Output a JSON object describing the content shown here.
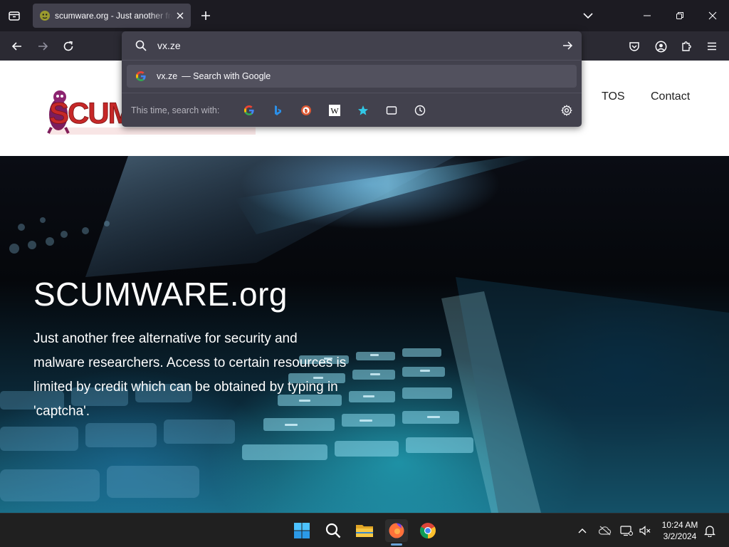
{
  "browser": {
    "tab": {
      "title": "scumware.org - Just another free alternative for security and malware researchers",
      "favicon": "scumware-favicon"
    },
    "urlbar": {
      "value": "vx.ze"
    },
    "suggestion": {
      "text": "vx.ze",
      "action": "— Search with Google",
      "favicon": "google-icon"
    },
    "one_off": {
      "label": "This time, search with:",
      "engines": [
        "google-icon",
        "bing-icon",
        "duckduckgo-icon",
        "wikipedia-icon",
        "bookmarks-star-icon",
        "tabs-icon",
        "history-icon"
      ]
    }
  },
  "site": {
    "nav": {
      "tos": "TOS",
      "contact": "Contact"
    },
    "hero": {
      "title": "SCUMWARE.org",
      "description": "Just another free alternative for security and malware researchers. Access to certain resources is limited by credit which can be obtained by typing in 'captcha'."
    }
  },
  "taskbar": {
    "pinned": [
      "windows-start-icon",
      "search-icon",
      "file-explorer-icon",
      "firefox-icon",
      "chrome-icon"
    ],
    "time": "10:24 AM",
    "date": "3/2/2024"
  },
  "colors": {
    "tabstrip": "#1c1b22",
    "toolbar": "#2b2a33",
    "panel": "#42414d",
    "selected_row": "#52515e",
    "logo_red": "#c62828",
    "taskbar": "#202020"
  }
}
